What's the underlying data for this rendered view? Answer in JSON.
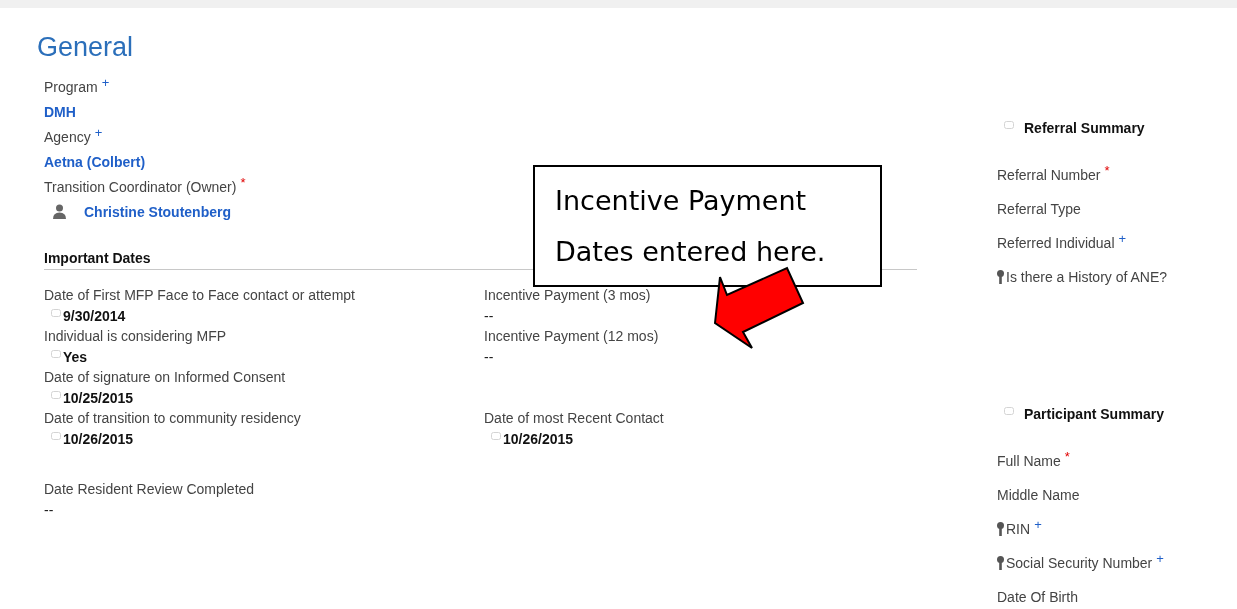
{
  "title": "General",
  "owner_fields": [
    {
      "label": "Program",
      "marker": {
        "text": "+",
        "kind": "recommended"
      },
      "value": "DMH",
      "kind": "link"
    },
    {
      "label": "Agency",
      "marker": {
        "text": "+",
        "kind": "recommended"
      },
      "value": "Aetna (Colbert)",
      "kind": "link"
    },
    {
      "label": "Transition Coordinator (Owner)",
      "marker": {
        "text": "*",
        "kind": "required"
      },
      "value": "Christine Stoutenberg",
      "kind": "user"
    }
  ],
  "important_dates": {
    "title": "Important Dates",
    "rows": [
      {
        "fields": [
          {
            "label": "Date of First MFP Face to Face contact or attempt",
            "value": "9/30/2014",
            "kind": "bold"
          },
          {
            "label": "Incentive Payment (3 mos)",
            "value": "--",
            "kind": "plain"
          }
        ]
      },
      {
        "fields": [
          {
            "label": "Individual is considering MFP",
            "value": "Yes",
            "kind": "bold"
          },
          {
            "label": "Incentive Payment (12 mos)",
            "value": "--",
            "kind": "plain"
          }
        ]
      },
      {
        "fields": [
          {
            "label": "Date of signature on Informed Consent",
            "value": "10/25/2015",
            "kind": "bold"
          }
        ]
      },
      {
        "fields": [
          {
            "label": "Date of transition to community residency",
            "value": "10/26/2015",
            "kind": "bold"
          },
          {
            "label": "Date of most Recent Contact",
            "value": "10/26/2015",
            "kind": "bold"
          }
        ]
      },
      {
        "fields": [
          {
            "label": "Date Resident Review Completed",
            "value": "--",
            "kind": "plain"
          }
        ]
      }
    ]
  },
  "callout": {
    "text": "Incentive Payment Dates entered here."
  },
  "sidebar": [
    {
      "title": "Referral Summary",
      "items": [
        {
          "label": "Referral Number",
          "marker": {
            "text": "*",
            "kind": "required"
          },
          "locked": false
        },
        {
          "label": "Referral Type",
          "locked": false
        },
        {
          "label": "Referred Individual",
          "marker": {
            "text": "+",
            "kind": "recommended"
          },
          "locked": false
        },
        {
          "label": "Is there a History of ANE?",
          "locked": true
        }
      ]
    },
    {
      "title": "Participant Summary",
      "items": [
        {
          "label": "Full Name",
          "marker": {
            "text": "*",
            "kind": "required"
          },
          "locked": false
        },
        {
          "label": "Middle Name",
          "locked": false
        },
        {
          "label": "RIN",
          "marker": {
            "text": "+",
            "kind": "recommended"
          },
          "locked": true
        },
        {
          "label": "Social Security Number",
          "marker": {
            "text": "+",
            "kind": "recommended"
          },
          "locked": true
        },
        {
          "label": "Date Of Birth",
          "locked": false
        }
      ]
    }
  ]
}
